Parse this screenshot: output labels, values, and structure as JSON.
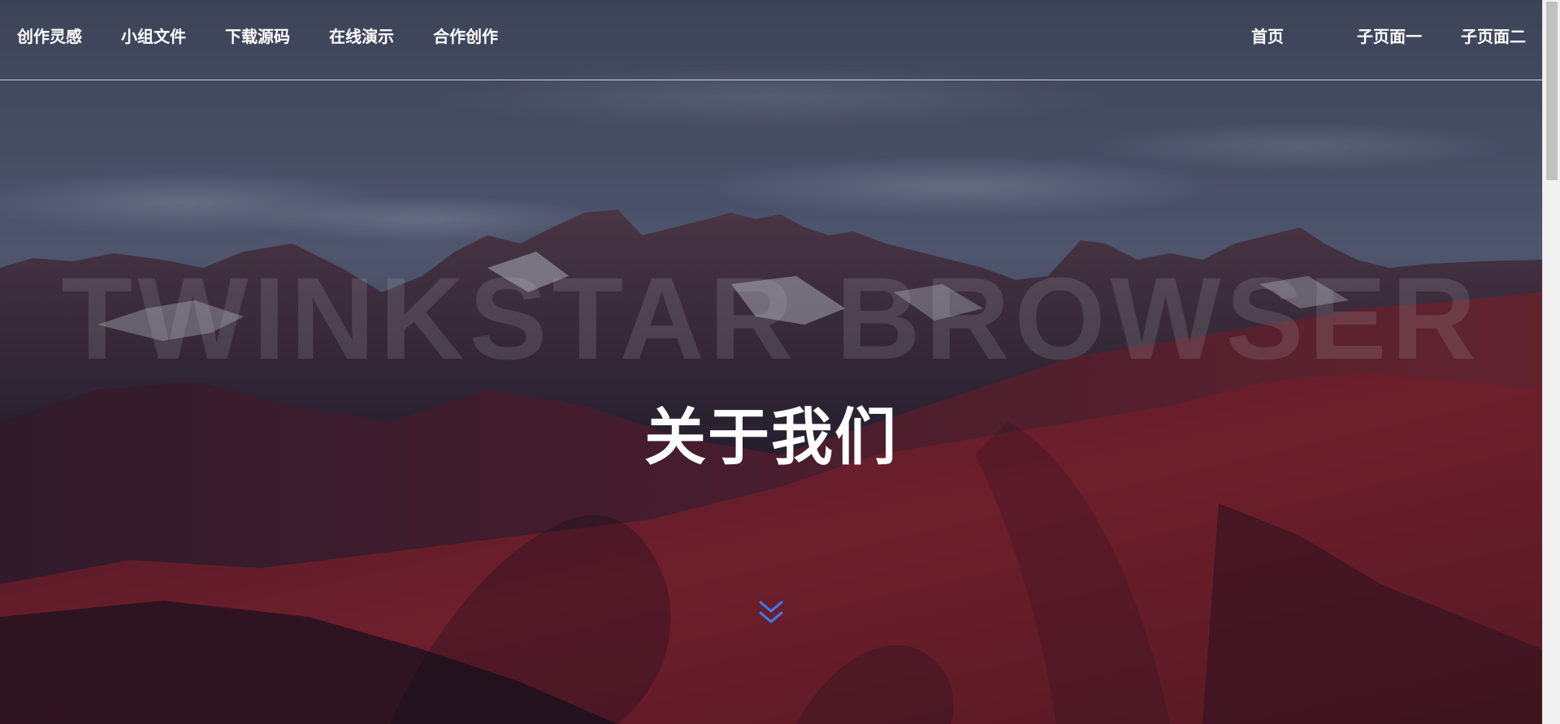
{
  "nav": {
    "left_items": [
      {
        "label": "创作灵感"
      },
      {
        "label": "小组文件"
      },
      {
        "label": "下载源码"
      },
      {
        "label": "在线演示"
      },
      {
        "label": "合作创作"
      }
    ],
    "right_items": [
      {
        "label": "首页"
      },
      {
        "label": "子页面一"
      },
      {
        "label": "子页面二"
      }
    ]
  },
  "hero": {
    "watermark": "TWINKSTAR BROWSER",
    "title": "关于我们",
    "scroll_icon": "double-chevron-down-icon"
  },
  "colors": {
    "nav_text": "#ffffff",
    "accent_arrow": "#3d7bf0",
    "sky_top": "#3a4256",
    "sky_mid": "#6d7894",
    "mountain_red": "#8a2431"
  }
}
